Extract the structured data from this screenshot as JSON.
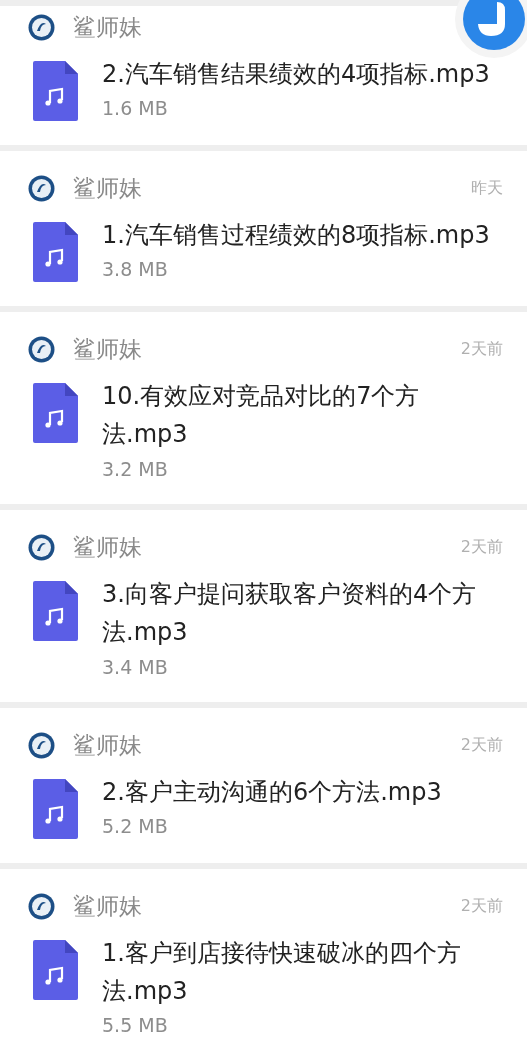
{
  "messages": [
    {
      "sender": "鲨师妹",
      "file": {
        "name": "2.汽车销售结果绩效的4项指标.mp3",
        "size": "1.6 MB"
      }
    },
    {
      "sender": "鲨师妹",
      "time": "昨天",
      "file": {
        "name": "1.汽车销售过程绩效的8项指标.mp3",
        "size": "3.8 MB"
      }
    },
    {
      "sender": "鲨师妹",
      "time": "2天前",
      "file": {
        "name": "10.有效应对竞品对比的7个方法.mp3",
        "size": "3.2 MB"
      }
    },
    {
      "sender": "鲨师妹",
      "time": "2天前",
      "file": {
        "name": "3.向客户提问获取客户资料的4个方法.mp3",
        "size": "3.4 MB"
      }
    },
    {
      "sender": "鲨师妹",
      "time": "2天前",
      "file": {
        "name": "2.客户主动沟通的6个方法.mp3",
        "size": "5.2 MB"
      }
    },
    {
      "sender": "鲨师妹",
      "time": "2天前",
      "file": {
        "name": "1.客户到店接待快速破冰的四个方法.mp3",
        "size": "5.5 MB"
      }
    }
  ]
}
